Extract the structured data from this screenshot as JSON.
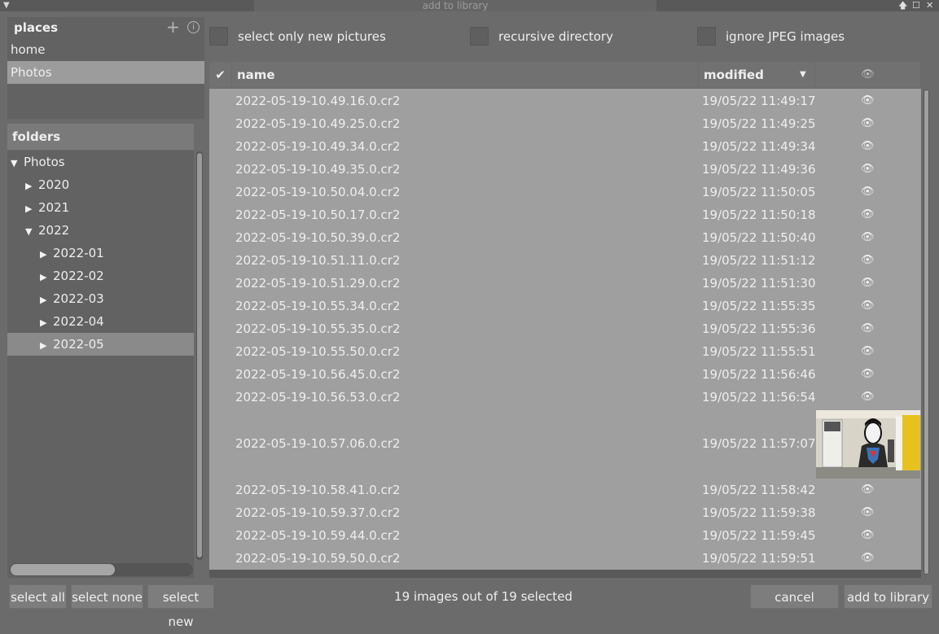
{
  "window": {
    "title": "add to library"
  },
  "places": {
    "header": "places",
    "add_icon": "+",
    "info_icon": "i",
    "items": [
      {
        "label": "home",
        "selected": false
      },
      {
        "label": "Photos",
        "selected": true
      }
    ]
  },
  "folders": {
    "header": "folders",
    "items": [
      {
        "label": "Photos",
        "expanded": true,
        "level": 0
      },
      {
        "label": "2020",
        "expanded": false,
        "level": 1
      },
      {
        "label": "2021",
        "expanded": false,
        "level": 1
      },
      {
        "label": "2022",
        "expanded": true,
        "level": 1
      },
      {
        "label": "2022-01",
        "expanded": false,
        "level": 2
      },
      {
        "label": "2022-02",
        "expanded": false,
        "level": 2
      },
      {
        "label": "2022-03",
        "expanded": false,
        "level": 2
      },
      {
        "label": "2022-04",
        "expanded": false,
        "level": 2
      },
      {
        "label": "2022-05",
        "expanded": false,
        "level": 2,
        "selected": true
      }
    ]
  },
  "options": {
    "new_pictures": "select only new pictures",
    "recursive": "recursive directory",
    "ignore_jpeg": "ignore JPEG images"
  },
  "table": {
    "check_header": "✔",
    "name_header": "name",
    "modified_header": "modified",
    "rows": [
      {
        "name": "2022-05-19-10.49.16.0.cr2",
        "modified": "19/05/22 11:49:17"
      },
      {
        "name": "2022-05-19-10.49.25.0.cr2",
        "modified": "19/05/22 11:49:25"
      },
      {
        "name": "2022-05-19-10.49.34.0.cr2",
        "modified": "19/05/22 11:49:34"
      },
      {
        "name": "2022-05-19-10.49.35.0.cr2",
        "modified": "19/05/22 11:49:36"
      },
      {
        "name": "2022-05-19-10.50.04.0.cr2",
        "modified": "19/05/22 11:50:05"
      },
      {
        "name": "2022-05-19-10.50.17.0.cr2",
        "modified": "19/05/22 11:50:18"
      },
      {
        "name": "2022-05-19-10.50.39.0.cr2",
        "modified": "19/05/22 11:50:40"
      },
      {
        "name": "2022-05-19-10.51.11.0.cr2",
        "modified": "19/05/22 11:51:12"
      },
      {
        "name": "2022-05-19-10.51.29.0.cr2",
        "modified": "19/05/22 11:51:30"
      },
      {
        "name": "2022-05-19-10.55.34.0.cr2",
        "modified": "19/05/22 11:55:35"
      },
      {
        "name": "2022-05-19-10.55.35.0.cr2",
        "modified": "19/05/22 11:55:36"
      },
      {
        "name": "2022-05-19-10.55.50.0.cr2",
        "modified": "19/05/22 11:55:51"
      },
      {
        "name": "2022-05-19-10.56.45.0.cr2",
        "modified": "19/05/22 11:56:46"
      },
      {
        "name": "2022-05-19-10.56.53.0.cr2",
        "modified": "19/05/22 11:56:54"
      },
      {
        "name": "2022-05-19-10.57.06.0.cr2",
        "modified": "19/05/22 11:57:07",
        "thumbnail": true
      },
      {
        "name": "2022-05-19-10.58.41.0.cr2",
        "modified": "19/05/22 11:58:42"
      },
      {
        "name": "2022-05-19-10.59.37.0.cr2",
        "modified": "19/05/22 11:59:38"
      },
      {
        "name": "2022-05-19-10.59.44.0.cr2",
        "modified": "19/05/22 11:59:45"
      },
      {
        "name": "2022-05-19-10.59.50.0.cr2",
        "modified": "19/05/22 11:59:51"
      }
    ]
  },
  "buttons": {
    "select_all": "select all",
    "select_none": "select none",
    "select_new": "select new",
    "cancel": "cancel",
    "add": "add to library"
  },
  "status": "19 images out of 19 selected"
}
